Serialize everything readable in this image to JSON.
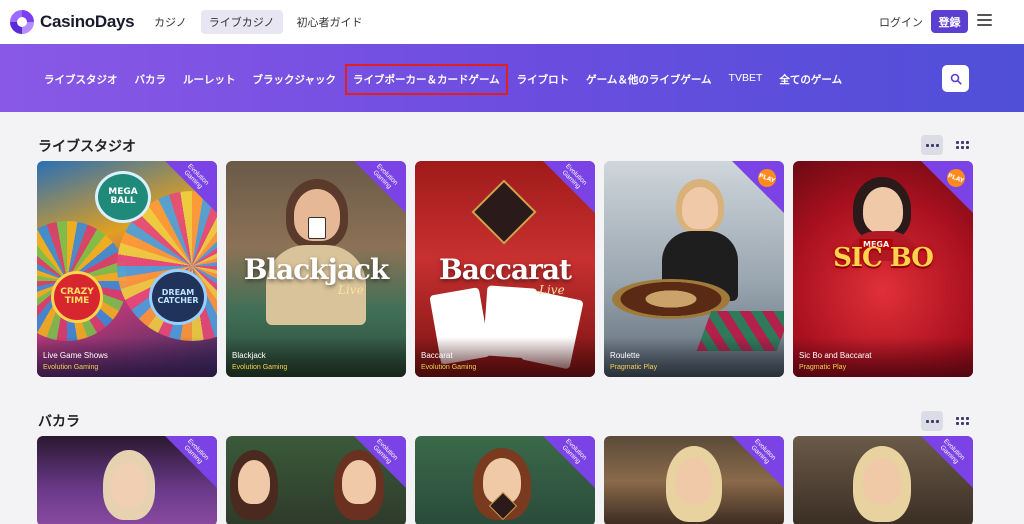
{
  "header": {
    "logo_text": "CasinoDays",
    "nav": [
      {
        "label": "カジノ",
        "active": false
      },
      {
        "label": "ライブカジノ",
        "active": true
      },
      {
        "label": "初心者ガイド",
        "active": false
      }
    ],
    "login_label": "ログイン",
    "register_label": "登録"
  },
  "categories": [
    {
      "label": "ライブスタジオ"
    },
    {
      "label": "バカラ"
    },
    {
      "label": "ルーレット"
    },
    {
      "label": "ブラックジャック"
    },
    {
      "label": "ライブポーカー＆カードゲーム",
      "highlighted": true
    },
    {
      "label": "ライブロト"
    },
    {
      "label": "ゲーム＆他のライブゲーム"
    },
    {
      "label": "TVBET"
    },
    {
      "label": "全てのゲーム"
    }
  ],
  "sections": [
    {
      "title": "ライブスタジオ",
      "games": [
        {
          "title": "Live Game Shows",
          "provider": "Evolution Gaming",
          "badge": "Evolution Gaming"
        },
        {
          "title": "Blackjack",
          "provider": "Evolution Gaming",
          "badge": "Evolution Gaming",
          "art_text": "Blackjack",
          "art_sub": "Live"
        },
        {
          "title": "Baccarat",
          "provider": "Evolution Gaming",
          "badge": "Evolution Gaming",
          "art_text": "Baccarat",
          "art_sub": "Live"
        },
        {
          "title": "Roulette",
          "provider": "Pragmatic Play",
          "badge": "PLAY"
        },
        {
          "title": "Sic Bo and Baccarat",
          "provider": "Pragmatic Play",
          "badge": "PLAY",
          "art_text": "SIC BO",
          "art_tag": "MEGA"
        }
      ]
    },
    {
      "title": "バカラ",
      "games": [
        {
          "badge": "Evolution Gaming"
        },
        {
          "badge": "Evolution Gaming"
        },
        {
          "badge": "Evolution Gaming"
        },
        {
          "badge": "Evolution Gaming"
        },
        {
          "badge": "Evolution Gaming"
        }
      ]
    }
  ],
  "wheel_labels": {
    "mega_ball": "MEGA BALL",
    "crazy_time": "CRAZY TIME",
    "dream_catcher": "DREAM CATCHER"
  },
  "colors": {
    "accent": "#5b3fd1",
    "band_start": "#8a58e6",
    "band_end": "#4f4fd8",
    "highlight_outline": "#e02020",
    "provider_text": "#f2d24d"
  }
}
